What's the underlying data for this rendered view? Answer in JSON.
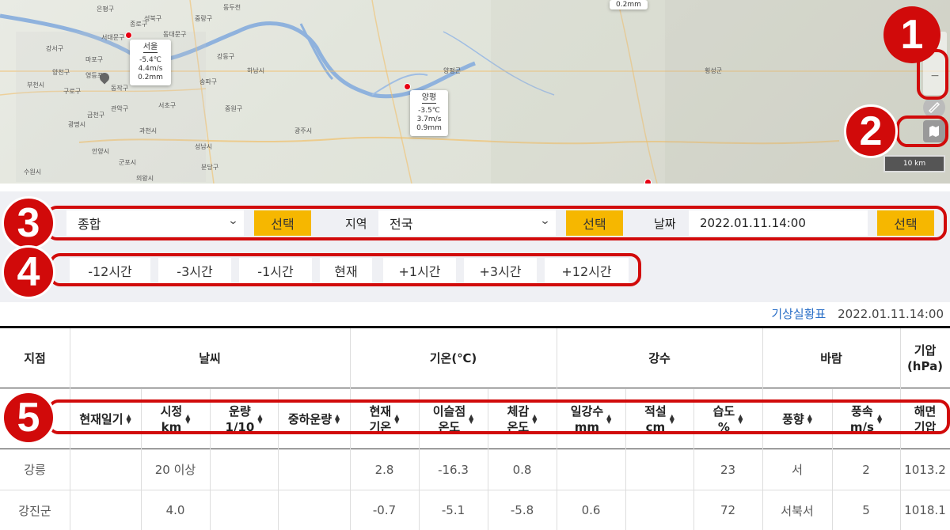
{
  "map": {
    "cities": [
      {
        "name": "은평구"
      },
      {
        "name": "성북구"
      },
      {
        "name": "중랑구"
      },
      {
        "name": "동두천"
      },
      {
        "name": "종로구"
      },
      {
        "name": "서대문구"
      },
      {
        "name": "동대문구"
      },
      {
        "name": "강서구"
      },
      {
        "name": "마포구"
      },
      {
        "name": "양천구"
      },
      {
        "name": "영등포"
      },
      {
        "name": "부천시"
      },
      {
        "name": "구로구"
      },
      {
        "name": "동작구"
      },
      {
        "name": "관악구"
      },
      {
        "name": "금천구"
      },
      {
        "name": "광명시"
      },
      {
        "name": "과천시"
      },
      {
        "name": "안양시"
      },
      {
        "name": "군포시"
      },
      {
        "name": "의왕시"
      },
      {
        "name": "서초구"
      },
      {
        "name": "강동구"
      },
      {
        "name": "송파구"
      },
      {
        "name": "성남시"
      },
      {
        "name": "분당구"
      },
      {
        "name": "중원구"
      },
      {
        "name": "하남시"
      },
      {
        "name": "광주시"
      },
      {
        "name": "양평군"
      },
      {
        "name": "횡성군"
      },
      {
        "name": "수원시"
      }
    ],
    "stations": [
      {
        "name": "서울",
        "temp": "-5.4℃",
        "wind": "4.4m/s",
        "rain": "0.2mm"
      },
      {
        "name": "양평",
        "temp": "-3.5℃",
        "wind": "3.7m/s",
        "rain": "0.9mm"
      }
    ],
    "top_card": "0.2mm",
    "scale": "10 km",
    "ctrl_minus": "−"
  },
  "controls": {
    "type_select": "종합",
    "select_btn": "선택",
    "region_label": "지역",
    "region_select": "전국",
    "date_label": "날짜",
    "date_value": "2022.01.11.14:00",
    "time_buttons": [
      "-12시간",
      "-3시간",
      "-1시간",
      "현재",
      "+1시간",
      "+3시간",
      "+12시간"
    ]
  },
  "caption": {
    "link": "기상실황표",
    "timestamp": "2022.01.11.14:00"
  },
  "table": {
    "groups": [
      "지점",
      "날씨",
      "기온(℃)",
      "강수",
      "바람",
      "기압\n(hPa)"
    ],
    "sub_headers": [
      "현재일기",
      "시정\nkm",
      "운량\n1/10",
      "중하운량",
      "현재\n기온",
      "이슬점\n온도",
      "체감\n온도",
      "일강수\nmm",
      "적설\ncm",
      "습도\n%",
      "풍향",
      "풍속\nm/s",
      "해면\n기압"
    ],
    "rows": [
      [
        "강릉",
        "",
        "20 이상",
        "",
        "",
        "2.8",
        "-16.3",
        "0.8",
        "",
        "",
        "23",
        "서",
        "2",
        "1013.2"
      ],
      [
        "강진군",
        "",
        "4.0",
        "",
        "",
        "-0.7",
        "-5.1",
        "-5.8",
        "0.6",
        "",
        "72",
        "서북서",
        "5",
        "1018.1"
      ]
    ]
  },
  "annotations": [
    "1",
    "2",
    "3",
    "4",
    "5"
  ],
  "colors": {
    "accent_yellow": "#f6b700",
    "annotation_red": "#d10a0a",
    "link_blue": "#2a6fc7",
    "pin_red": "#e60012"
  }
}
